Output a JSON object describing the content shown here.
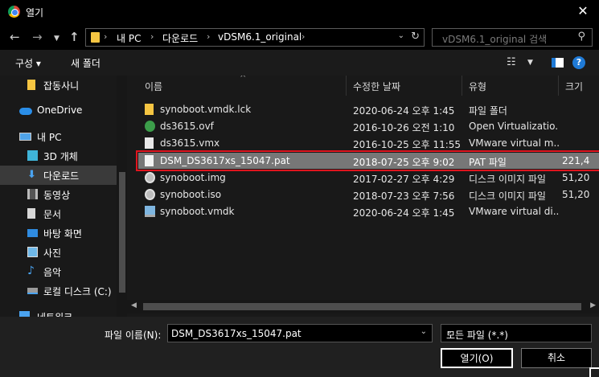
{
  "window": {
    "title": "열기"
  },
  "nav": {
    "back_icon": "arrow-left-icon",
    "forward_icon": "arrow-right-icon",
    "up_icon": "arrow-up-icon",
    "breadcrumb": [
      "내 PC",
      "다운로드",
      "vDSM6.1_original"
    ],
    "search_placeholder": "vDSM6.1_original 검색"
  },
  "toolbar": {
    "organize_label": "구성 ▾",
    "new_folder_label": "새 폴더"
  },
  "sidebar": {
    "items": [
      {
        "label": "잡동사니",
        "icon": "folder-icon"
      },
      {
        "label": "OneDrive",
        "icon": "cloud-icon"
      },
      {
        "label": "내 PC",
        "icon": "computer-icon"
      },
      {
        "label": "3D 개체",
        "icon": "cube-icon"
      },
      {
        "label": "다운로드",
        "icon": "download-icon"
      },
      {
        "label": "동영상",
        "icon": "film-icon"
      },
      {
        "label": "문서",
        "icon": "document-icon"
      },
      {
        "label": "바탕 화면",
        "icon": "desktop-icon"
      },
      {
        "label": "사진",
        "icon": "picture-icon"
      },
      {
        "label": "음악",
        "icon": "music-icon"
      },
      {
        "label": "로컬 디스크 (C:)",
        "icon": "drive-icon"
      },
      {
        "label": "네트워크",
        "icon": "network-icon"
      }
    ]
  },
  "filelist": {
    "headers": [
      "이름",
      "수정한 날짜",
      "유형",
      "크기"
    ],
    "rows": [
      {
        "name": "synoboot.vmdk.lck",
        "date": "2020-06-24 오후 1:45",
        "type": "파일 폴더",
        "size": "",
        "icon": "folder-icon"
      },
      {
        "name": "ds3615.ovf",
        "date": "2016-10-26 오전 1:10",
        "type": "Open Virtualizatio...",
        "size": "",
        "icon": "ovf-file-icon"
      },
      {
        "name": "ds3615.vmx",
        "date": "2016-10-25 오후 11:55",
        "type": "VMware virtual m...",
        "size": "",
        "icon": "file-icon"
      },
      {
        "name": "DSM_DS3617xs_15047.pat",
        "date": "2018-07-25 오후 9:02",
        "type": "PAT 파일",
        "size": "221,4",
        "icon": "file-icon"
      },
      {
        "name": "synoboot.img",
        "date": "2017-02-27 오후 4:29",
        "type": "디스크 이미지 파일",
        "size": "51,20",
        "icon": "disk-image-icon"
      },
      {
        "name": "synoboot.iso",
        "date": "2018-07-23 오후 7:56",
        "type": "디스크 이미지 파일",
        "size": "51,20",
        "icon": "disk-image-icon"
      },
      {
        "name": "synoboot.vmdk",
        "date": "2020-06-24 오후 1:45",
        "type": "VMware virtual di...",
        "size": "",
        "icon": "vmdk-file-icon"
      }
    ],
    "selected_index": 3
  },
  "footer": {
    "filename_label": "파일 이름(N):",
    "filename_value": "DSM_DS3617xs_15047.pat",
    "filetype_value": "모든 파일 (*.*)",
    "open_label": "열기(O)",
    "cancel_label": "취소"
  },
  "colors": {
    "accent": "#1f7ad6",
    "selection_outline": "#e0141e",
    "selection_bg": "#777777"
  }
}
